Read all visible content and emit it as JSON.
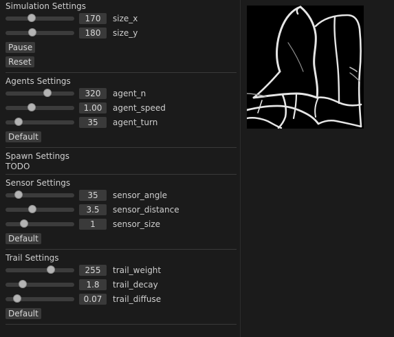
{
  "sections": {
    "simulation": {
      "title": "Simulation Settings",
      "sliders": [
        {
          "value": "170",
          "label": "size_x",
          "fraction": 0.36
        },
        {
          "value": "180",
          "label": "size_y",
          "fraction": 0.38
        }
      ],
      "buttons": [
        "Pause",
        "Reset"
      ]
    },
    "agents": {
      "title": "Agents Settings",
      "sliders": [
        {
          "value": "320",
          "label": "agent_n",
          "fraction": 0.63
        },
        {
          "value": "1.00",
          "label": "agent_speed",
          "fraction": 0.36
        },
        {
          "value": "35",
          "label": "agent_turn",
          "fraction": 0.15
        }
      ],
      "button": "Default"
    },
    "spawn": {
      "title": "Spawn Settings",
      "text": "TODO"
    },
    "sensor": {
      "title": "Sensor Settings",
      "sliders": [
        {
          "value": "35",
          "label": "sensor_angle",
          "fraction": 0.15
        },
        {
          "value": "3.5",
          "label": "sensor_distance",
          "fraction": 0.37
        },
        {
          "value": "1",
          "label": "sensor_size",
          "fraction": 0.24
        }
      ],
      "button": "Default"
    },
    "trail": {
      "title": "Trail Settings",
      "sliders": [
        {
          "value": "255",
          "label": "trail_weight",
          "fraction": 0.68
        },
        {
          "value": "1.8",
          "label": "trail_decay",
          "fraction": 0.22
        },
        {
          "value": "0.07",
          "label": "trail_diffuse",
          "fraction": 0.12
        }
      ],
      "button": "Default"
    }
  },
  "preview": {
    "icon": "simulation-preview-image"
  }
}
